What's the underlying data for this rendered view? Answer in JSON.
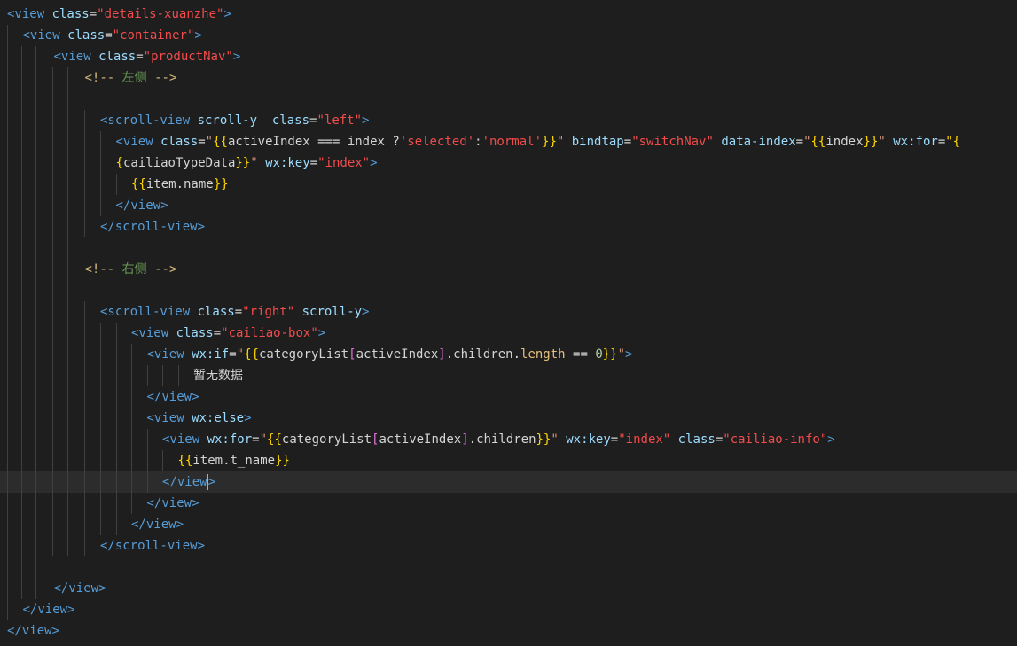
{
  "colors": {
    "background": "#1e1e1e",
    "current_line": "#2c2c2c",
    "tag": "#569cd6",
    "attr": "#9cdcfe",
    "string": "#ce9178",
    "comment": "#6a9955",
    "text": "#d4d4d4"
  },
  "lines": [
    {
      "indent": 0,
      "tokens": [
        [
          "<view ",
          "t-tag"
        ],
        [
          "class",
          "t-attr"
        ],
        [
          "=",
          "t-op"
        ],
        [
          "\"details-xuanzhe\"",
          "t-str2"
        ],
        [
          ">",
          "t-tag"
        ]
      ]
    },
    {
      "indent": 1,
      "tokens": [
        [
          "<view ",
          "t-tag"
        ],
        [
          "class",
          "t-attr"
        ],
        [
          "=",
          "t-op"
        ],
        [
          "\"container\"",
          "t-str2"
        ],
        [
          ">",
          "t-tag"
        ]
      ]
    },
    {
      "indent": 3,
      "tokens": [
        [
          "<view ",
          "t-tag"
        ],
        [
          "class",
          "t-attr"
        ],
        [
          "=",
          "t-op"
        ],
        [
          "\"productNav\"",
          "t-str2"
        ],
        [
          ">",
          "t-tag"
        ]
      ]
    },
    {
      "indent": 5,
      "tokens": [
        [
          "<!-- ",
          "t-com"
        ],
        [
          "左侧",
          "t-cm-text"
        ],
        [
          " -->",
          "t-com"
        ]
      ]
    },
    {
      "indent": 5,
      "tokens": []
    },
    {
      "indent": 6,
      "tokens": [
        [
          "<scroll-view ",
          "t-tag"
        ],
        [
          "scroll-y  ",
          "t-attr"
        ],
        [
          "class",
          "t-attr"
        ],
        [
          "=",
          "t-op"
        ],
        [
          "\"left\"",
          "t-str2"
        ],
        [
          ">",
          "t-tag"
        ]
      ]
    },
    {
      "indent": 7,
      "tokens": [
        [
          "<view ",
          "t-tag"
        ],
        [
          "class",
          "t-attr"
        ],
        [
          "=",
          "t-op"
        ],
        [
          "\"",
          "t-str"
        ],
        [
          "{{",
          "t-brace2"
        ],
        [
          "activeIndex === index ?",
          "t-text"
        ],
        [
          "'selected'",
          "t-str2"
        ],
        [
          ":",
          "t-text"
        ],
        [
          "'normal'",
          "t-str2"
        ],
        [
          "}}",
          "t-brace2"
        ],
        [
          "\" ",
          "t-str"
        ],
        [
          "bindtap",
          "t-attr"
        ],
        [
          "=",
          "t-op"
        ],
        [
          "\"switchNav\"",
          "t-str2"
        ],
        [
          " data-index",
          "t-attr"
        ],
        [
          "=",
          "t-op"
        ],
        [
          "\"",
          "t-str"
        ],
        [
          "{{",
          "t-brace2"
        ],
        [
          "index",
          "t-text"
        ],
        [
          "}}",
          "t-brace2"
        ],
        [
          "\" ",
          "t-str"
        ],
        [
          "wx:for",
          "t-attr"
        ],
        [
          "=",
          "t-op"
        ],
        [
          "\"{",
          "t-brace2"
        ]
      ]
    },
    {
      "indent": 7,
      "tokens": [
        [
          "{",
          "t-brace2"
        ],
        [
          "cailiaoTypeData",
          "t-text"
        ],
        [
          "}}",
          "t-brace2"
        ],
        [
          "\" ",
          "t-str"
        ],
        [
          "wx:key",
          "t-attr"
        ],
        [
          "=",
          "t-op"
        ],
        [
          "\"index\"",
          "t-str2"
        ],
        [
          ">",
          "t-tag"
        ]
      ]
    },
    {
      "indent": 8,
      "tokens": [
        [
          "{{",
          "t-brace2"
        ],
        [
          "item.name",
          "t-text"
        ],
        [
          "}}",
          "t-brace2"
        ]
      ]
    },
    {
      "indent": 7,
      "tokens": [
        [
          "</view>",
          "t-tag"
        ]
      ]
    },
    {
      "indent": 6,
      "tokens": [
        [
          "</scroll-view>",
          "t-tag"
        ]
      ]
    },
    {
      "indent": 5,
      "tokens": []
    },
    {
      "indent": 5,
      "tokens": [
        [
          "<!-- ",
          "t-com"
        ],
        [
          "右侧",
          "t-cm-text"
        ],
        [
          " -->",
          "t-com"
        ]
      ]
    },
    {
      "indent": 5,
      "tokens": []
    },
    {
      "indent": 6,
      "tokens": [
        [
          "<scroll-view ",
          "t-tag"
        ],
        [
          "class",
          "t-attr"
        ],
        [
          "=",
          "t-op"
        ],
        [
          "\"right\"",
          "t-str2"
        ],
        [
          " scroll-y",
          "t-attr"
        ],
        [
          ">",
          "t-tag"
        ]
      ]
    },
    {
      "indent": 8,
      "tokens": [
        [
          "<view ",
          "t-tag"
        ],
        [
          "class",
          "t-attr"
        ],
        [
          "=",
          "t-op"
        ],
        [
          "\"cailiao-box\"",
          "t-str2"
        ],
        [
          ">",
          "t-tag"
        ]
      ]
    },
    {
      "indent": 9,
      "tokens": [
        [
          "<view ",
          "t-tag"
        ],
        [
          "wx:if",
          "t-attr"
        ],
        [
          "=",
          "t-op"
        ],
        [
          "\"",
          "t-str"
        ],
        [
          "{{",
          "t-brace2"
        ],
        [
          "categoryList",
          "t-text"
        ],
        [
          "[",
          "t-brace"
        ],
        [
          "activeIndex",
          "t-text"
        ],
        [
          "]",
          "t-brace"
        ],
        [
          ".children.",
          "t-text"
        ],
        [
          "length",
          "t-key"
        ],
        [
          " == ",
          "t-op"
        ],
        [
          "0",
          "t-num"
        ],
        [
          "}}",
          "t-brace2"
        ],
        [
          "\"",
          "t-str"
        ],
        [
          ">",
          "t-tag"
        ]
      ]
    },
    {
      "indent": 12,
      "tokens": [
        [
          "暂无数据",
          "t-text"
        ]
      ]
    },
    {
      "indent": 9,
      "tokens": [
        [
          "</view>",
          "t-tag"
        ]
      ]
    },
    {
      "indent": 9,
      "tokens": [
        [
          "<view ",
          "t-tag"
        ],
        [
          "wx:else",
          "t-attr"
        ],
        [
          ">",
          "t-tag"
        ]
      ]
    },
    {
      "indent": 10,
      "tokens": [
        [
          "<view ",
          "t-tag"
        ],
        [
          "wx:for",
          "t-attr"
        ],
        [
          "=",
          "t-op"
        ],
        [
          "\"",
          "t-str"
        ],
        [
          "{{",
          "t-brace2"
        ],
        [
          "categoryList",
          "t-text"
        ],
        [
          "[",
          "t-brace"
        ],
        [
          "activeIndex",
          "t-text"
        ],
        [
          "]",
          "t-brace"
        ],
        [
          ".children",
          "t-text"
        ],
        [
          "}}",
          "t-brace2"
        ],
        [
          "\" ",
          "t-str"
        ],
        [
          "wx:key",
          "t-attr"
        ],
        [
          "=",
          "t-op"
        ],
        [
          "\"index\"",
          "t-str2"
        ],
        [
          " class",
          "t-attr"
        ],
        [
          "=",
          "t-op"
        ],
        [
          "\"cailiao-info\"",
          "t-str2"
        ],
        [
          ">",
          "t-tag"
        ]
      ]
    },
    {
      "indent": 11,
      "tokens": [
        [
          "{{",
          "t-brace2"
        ],
        [
          "item.t_name",
          "t-text"
        ],
        [
          "}}",
          "t-brace2"
        ]
      ]
    },
    {
      "indent": 10,
      "current": true,
      "tokens": [
        [
          "</view",
          "t-tag"
        ],
        [
          "CURSOR",
          "cursor"
        ],
        [
          ">",
          "t-tag"
        ]
      ]
    },
    {
      "indent": 9,
      "tokens": [
        [
          "</view>",
          "t-tag"
        ]
      ]
    },
    {
      "indent": 8,
      "tokens": [
        [
          "</view>",
          "t-tag"
        ]
      ]
    },
    {
      "indent": 6,
      "tokens": [
        [
          "</scroll-view>",
          "t-tag"
        ]
      ]
    },
    {
      "indent": 3,
      "tokens": []
    },
    {
      "indent": 3,
      "tokens": [
        [
          "</view>",
          "t-tag"
        ]
      ]
    },
    {
      "indent": 1,
      "tokens": [
        [
          "</view>",
          "t-tag"
        ]
      ]
    },
    {
      "indent": 0,
      "tokens": [
        [
          "</view>",
          "t-tag"
        ]
      ]
    }
  ]
}
